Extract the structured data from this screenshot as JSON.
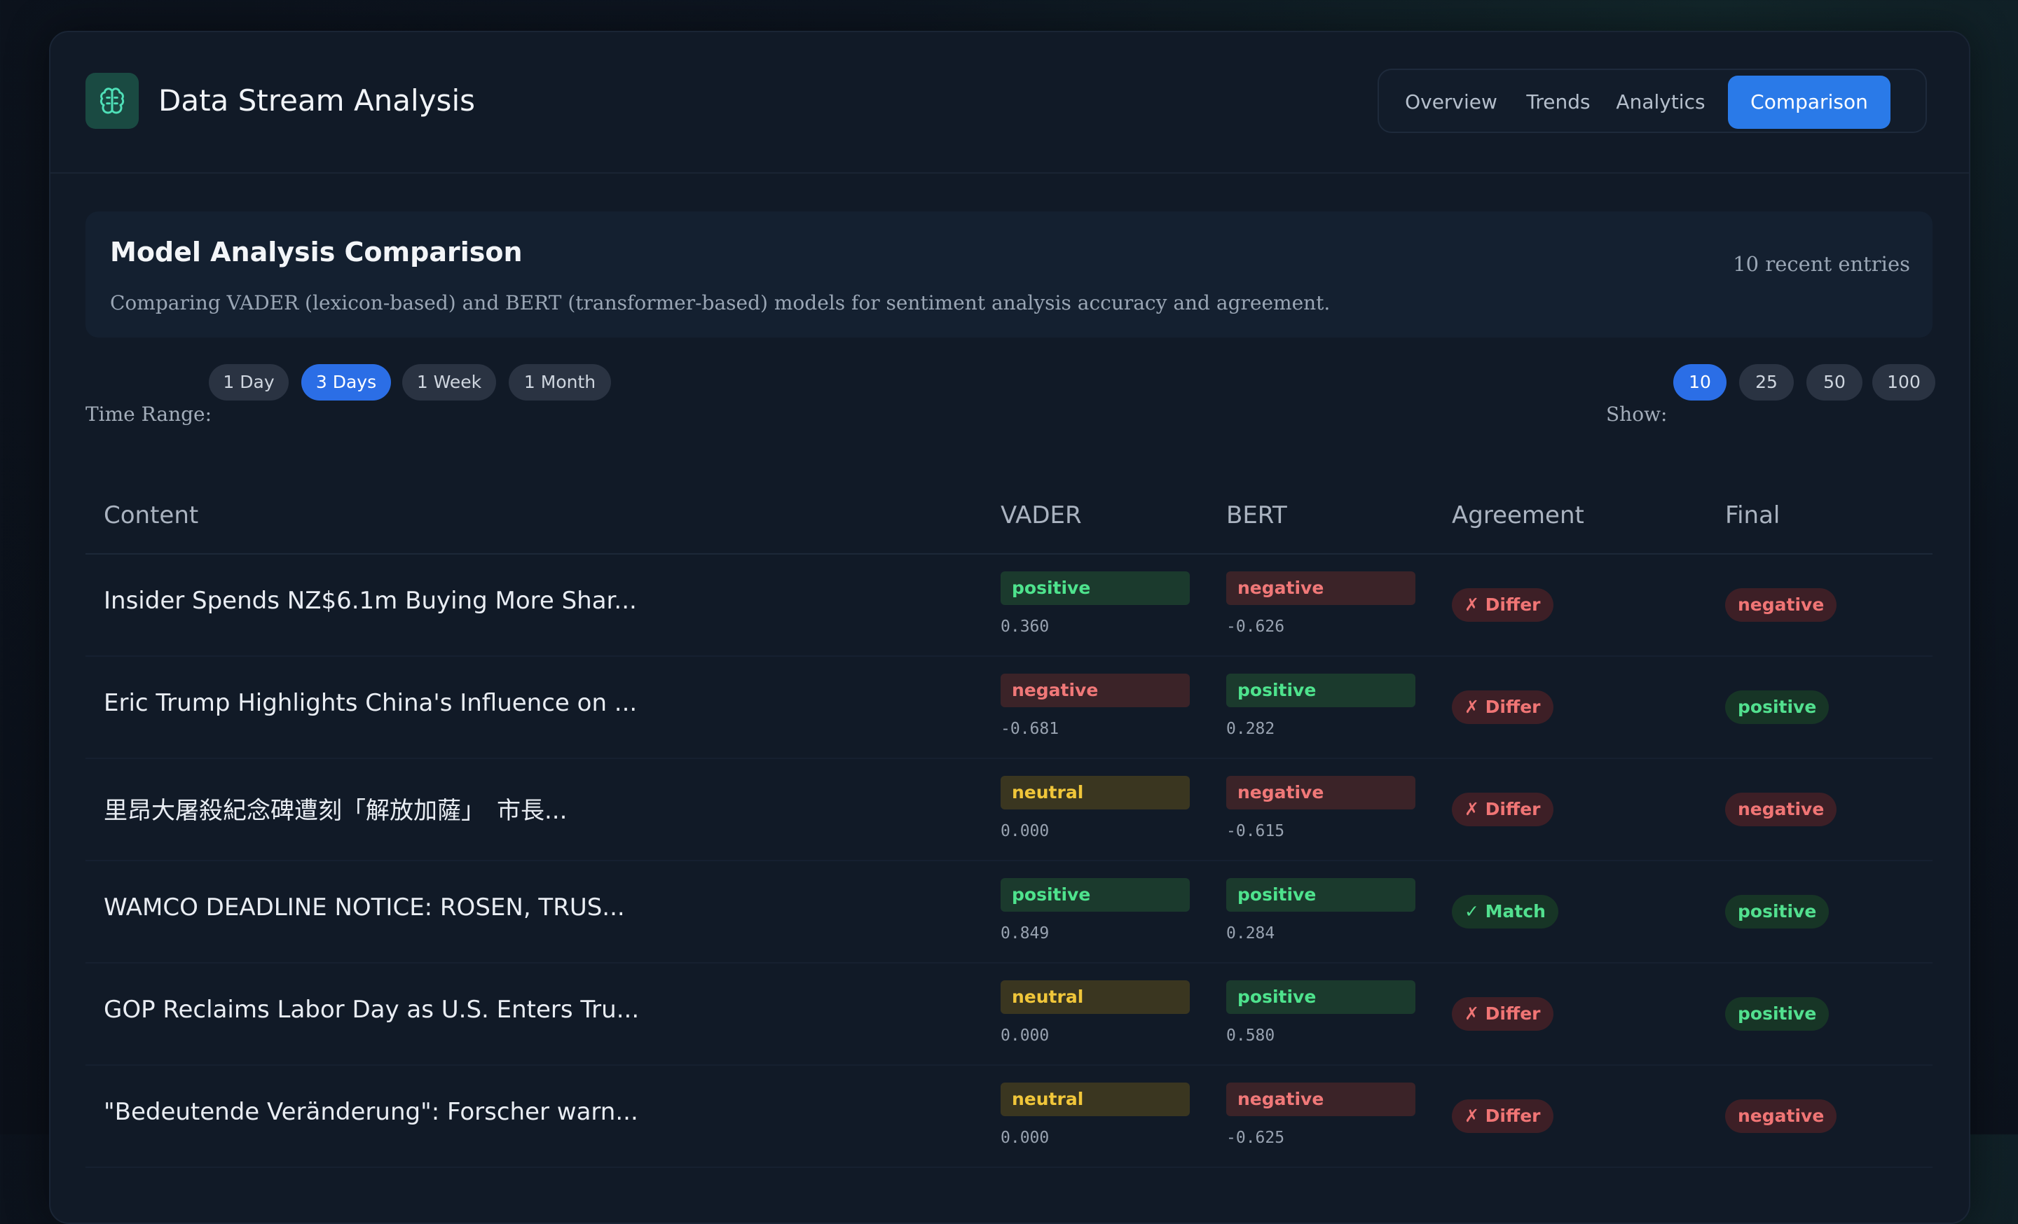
{
  "app": {
    "title": "Data Stream Analysis",
    "logo_icon": "brain-icon",
    "accent": "#2a7ae8"
  },
  "nav": {
    "tabs": [
      {
        "label": "Overview",
        "active": false
      },
      {
        "label": "Trends",
        "active": false
      },
      {
        "label": "Analytics",
        "active": false
      },
      {
        "label": "Comparison",
        "active": true
      }
    ]
  },
  "summary": {
    "title": "Model Analysis Comparison",
    "description": "Comparing VADER (lexicon-based) and BERT (transformer-based) models for sentiment analysis accuracy and agreement.",
    "count": "10 recent entries"
  },
  "filters": {
    "time_range_label": "Time Range:",
    "time_ranges": [
      "1 Day",
      "3 Days",
      "1 Week",
      "1 Month"
    ],
    "time_range_selected": "3 Days",
    "show_label": "Show:",
    "show_options": [
      "10",
      "25",
      "50",
      "100"
    ],
    "show_selected": "10"
  },
  "table": {
    "headers": {
      "content": "Content",
      "vader": "VADER",
      "bert": "BERT",
      "agreement": "Agreement",
      "final": "Final"
    },
    "rows": [
      {
        "content": "Insider Spends NZ$6.1m Buying More Shar...",
        "vader": "positive",
        "vader_score": "0.360",
        "bert": "negative",
        "bert_score": "-0.626",
        "agreement": "✗ Differ",
        "final": "negative"
      },
      {
        "content": "Eric Trump Highlights China's Influence on ...",
        "vader": "negative",
        "vader_score": "-0.681",
        "bert": "positive",
        "bert_score": "0.282",
        "agreement": "✗ Differ",
        "final": "positive"
      },
      {
        "content": "里昂大屠殺紀念碑遭刻「解放加薩」　市長...",
        "vader": "neutral",
        "vader_score": "0.000",
        "bert": "negative",
        "bert_score": "-0.615",
        "agreement": "✗ Differ",
        "final": "negative"
      },
      {
        "content": "WAMCO DEADLINE NOTICE: ROSEN, TRUS...",
        "vader": "positive",
        "vader_score": "0.849",
        "bert": "positive",
        "bert_score": "0.284",
        "agreement": "✓ Match",
        "final": "positive"
      },
      {
        "content": "GOP Reclaims Labor Day as U.S. Enters Tru...",
        "vader": "neutral",
        "vader_score": "0.000",
        "bert": "positive",
        "bert_score": "0.580",
        "agreement": "✗ Differ",
        "final": "positive"
      },
      {
        "content": "\"Bedeutende Veränderung\": Forscher warn...",
        "vader": "neutral",
        "vader_score": "0.000",
        "bert": "negative",
        "bert_score": "-0.625",
        "agreement": "✗ Differ",
        "final": "negative"
      }
    ]
  }
}
